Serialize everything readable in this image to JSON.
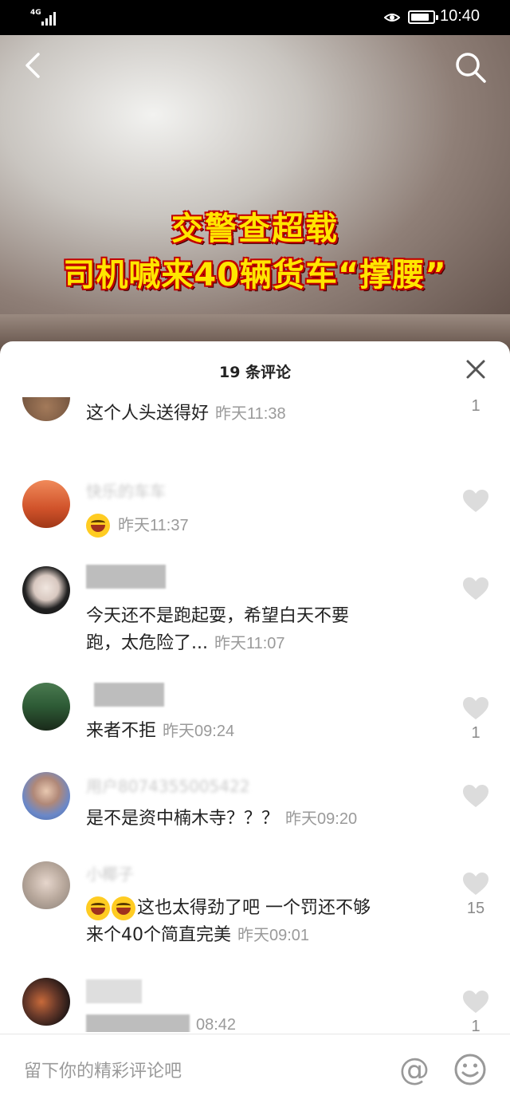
{
  "status_bar": {
    "network": "4G",
    "time": "10:40"
  },
  "video": {
    "caption_line1": "交警查超载",
    "caption_line2": "司机喊来40辆货车“撑腰”"
  },
  "comments_panel": {
    "title": "19 条评论",
    "input_placeholder": "留下你的精彩评论吧",
    "at_symbol": "@",
    "comments": [
      {
        "text": "这个人头送得好",
        "time": "昨天11:38",
        "likes": "1"
      },
      {
        "username": "快乐的车车",
        "text": "",
        "time": "昨天11:37",
        "likes": ""
      },
      {
        "username": "张家老弟",
        "text": "今天还不是跑起耍，希望白天不要跑，太危险了...",
        "text_line1": "今天还不是跑起耍，希望白天不要",
        "text_line2": "跑，太危险了...",
        "time": "昨天11:07",
        "likes": ""
      },
      {
        "username": "",
        "text": "来者不拒",
        "time": "昨天09:24",
        "likes": "1"
      },
      {
        "username": "用户8074355005422",
        "text": "是不是资中楠木寺？？？",
        "time": "昨天09:20",
        "likes": ""
      },
      {
        "username": "小椰子",
        "text_line1": "这也太得劲了吧 一个罚还不够",
        "text_line2": "来个40个简直完美",
        "time": "昨天09:01",
        "likes": "15"
      },
      {
        "username": "",
        "text": "",
        "time": "08:42",
        "likes": "1"
      }
    ]
  }
}
